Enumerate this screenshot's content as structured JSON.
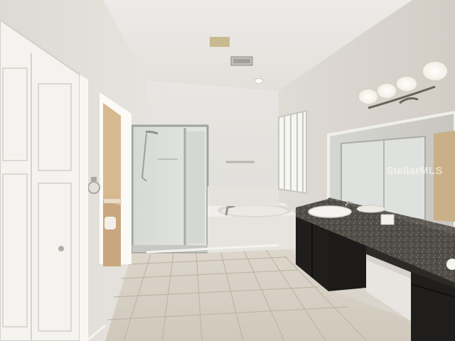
{
  "watermark": {
    "text": "StellarMLS"
  }
}
